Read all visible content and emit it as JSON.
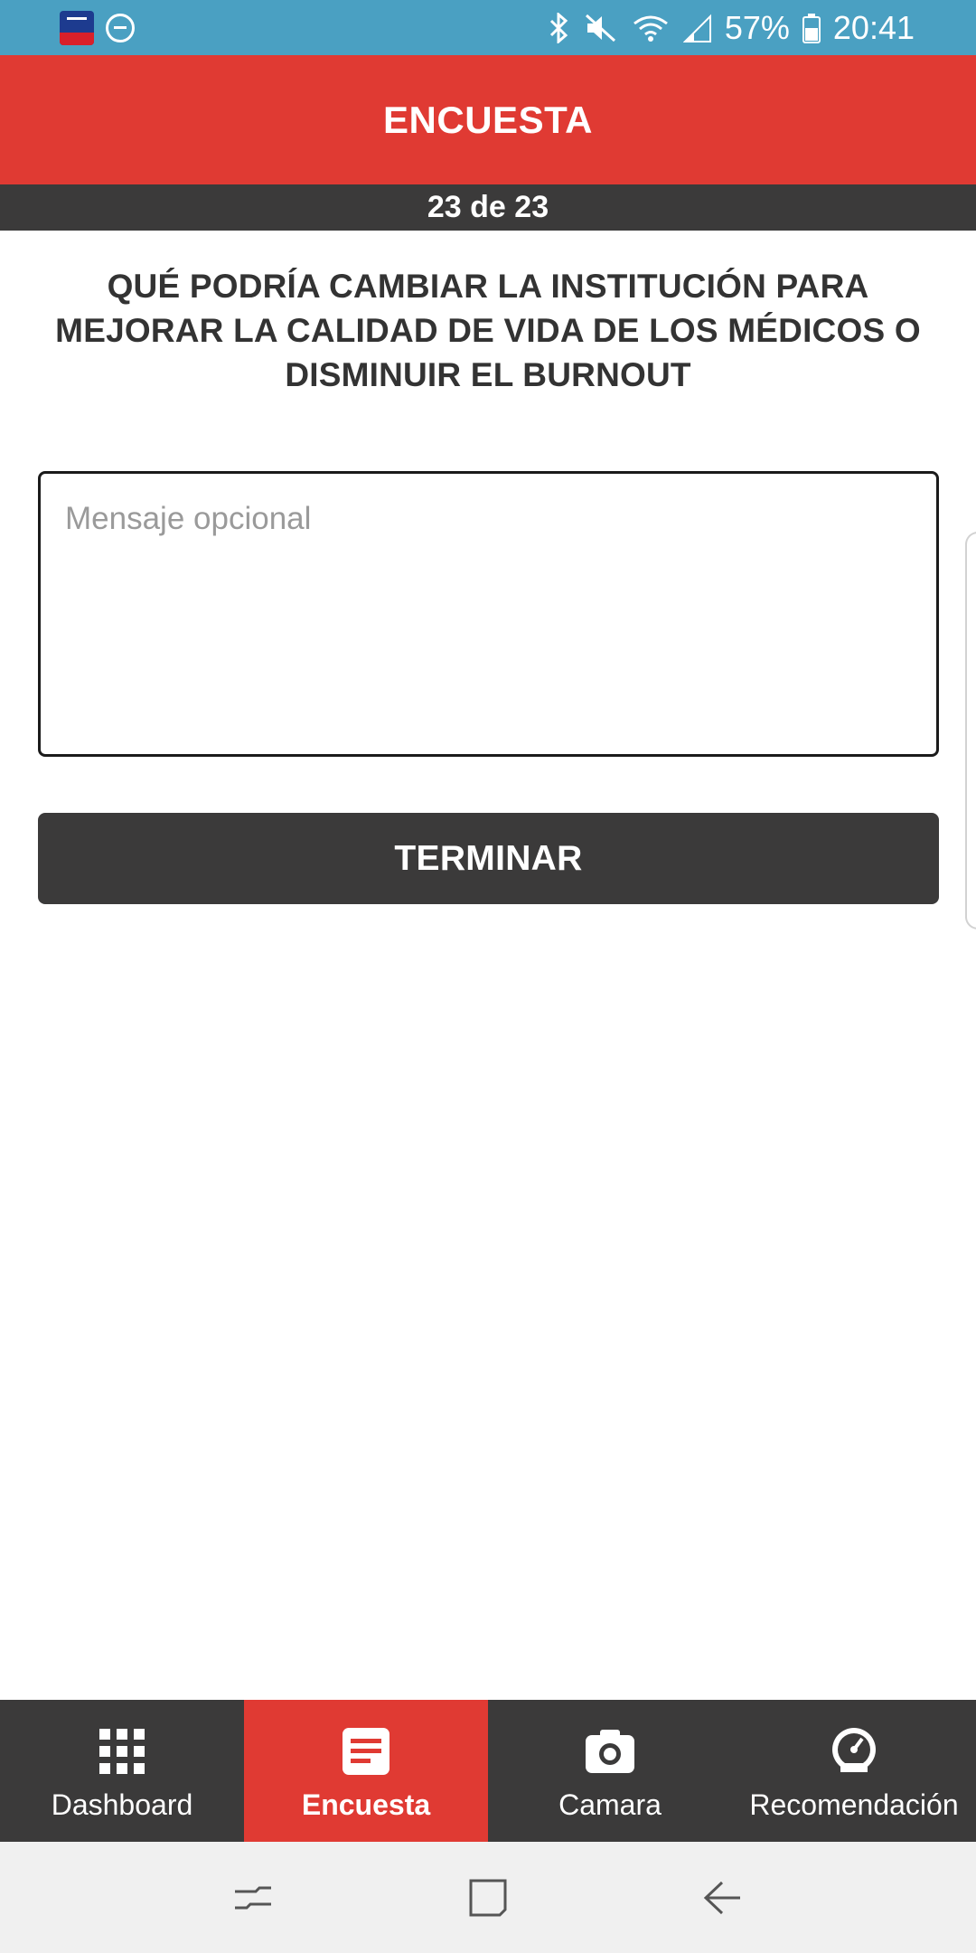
{
  "status_bar": {
    "battery": "57%",
    "time": "20:41"
  },
  "app_bar": {
    "title": "ENCUESTA"
  },
  "survey": {
    "progress": "23 de 23",
    "question": "QUÉ PODRÍA CAMBIAR LA INSTITUCIÓN PARA MEJORAR LA CALIDAD DE VIDA DE LOS MÉDICOS O DISMINUIR EL BURNOUT",
    "message_placeholder": "Mensaje opcional",
    "message_value": "",
    "finish_label": "TERMINAR"
  },
  "bottom_nav": {
    "items": [
      {
        "label": "Dashboard",
        "icon": "grid-icon",
        "active": false
      },
      {
        "label": "Encuesta",
        "icon": "document-icon",
        "active": true
      },
      {
        "label": "Camara",
        "icon": "camera-icon",
        "active": false
      },
      {
        "label": "Recomendación",
        "icon": "speedometer-icon",
        "active": false
      }
    ]
  },
  "colors": {
    "status_bar": "#4aa0c2",
    "accent_red": "#e03a33",
    "dark": "#3b3a3a",
    "system_nav": "#f0f0f0"
  }
}
